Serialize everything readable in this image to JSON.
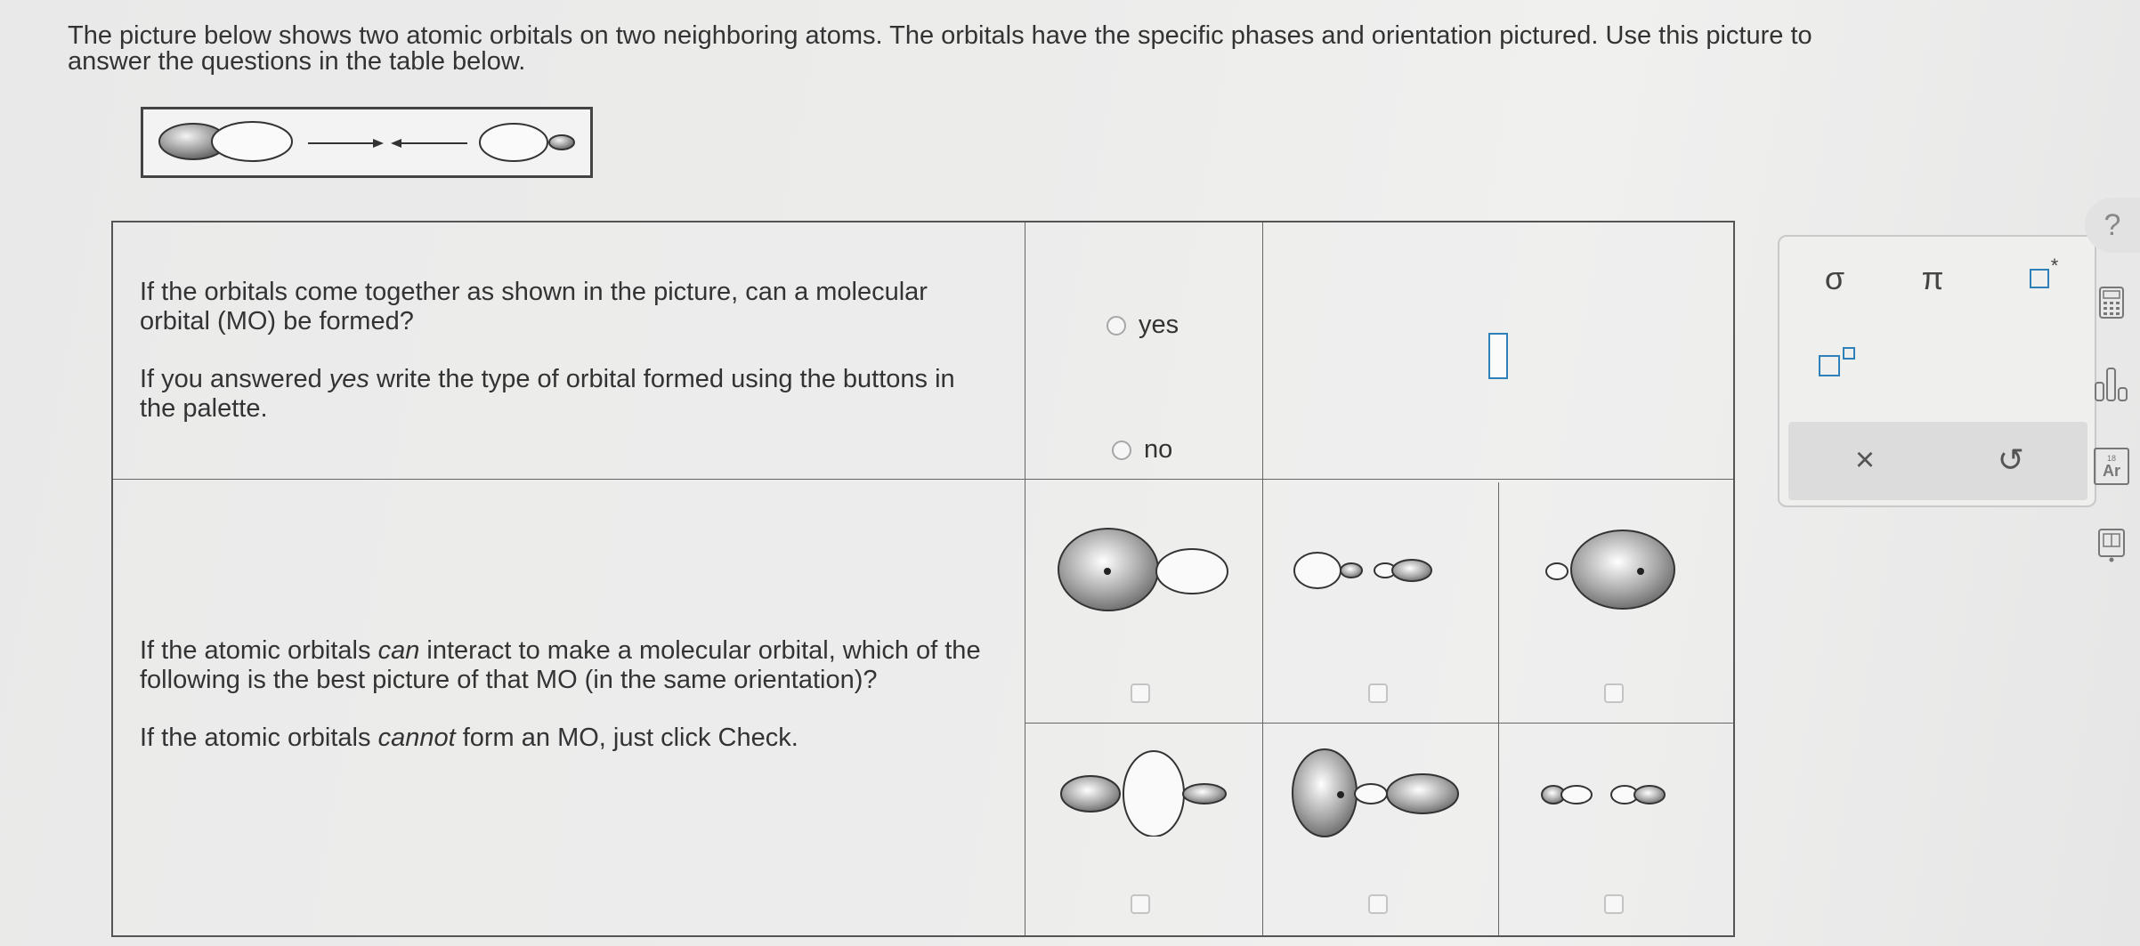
{
  "intro": {
    "line1": "The picture below shows two atomic orbitals on two neighboring atoms. The orbitals have the specific phases and orientation pictured. Use this picture to",
    "line2": "answer the questions in the table below."
  },
  "question1": {
    "para1": "If the orbitals come together as shown in the picture, can a molecular orbital (MO) be formed?",
    "para2_pre": "If you answered ",
    "para2_em": "yes",
    "para2_post": " write the type of orbital formed using the buttons in the palette.",
    "option_yes": "yes",
    "option_no": "no"
  },
  "question2": {
    "para1_pre": "If the atomic orbitals ",
    "para1_em": "can",
    "para1_post": " interact to make a molecular orbital, which of the following is the best picture of that MO (in the same orientation)?",
    "para2_pre": "If the atomic orbitals ",
    "para2_em": "cannot",
    "para2_post": " form an MO, just click Check."
  },
  "palette": {
    "sigma": "σ",
    "pi": "π",
    "star_suffix": "*",
    "clear": "×",
    "undo": "↺"
  },
  "side_tools": {
    "help": "?",
    "periodic_label": "Ar",
    "periodic_number": "18"
  },
  "colors": {
    "accent": "#2f7fb8",
    "border": "#555555"
  }
}
